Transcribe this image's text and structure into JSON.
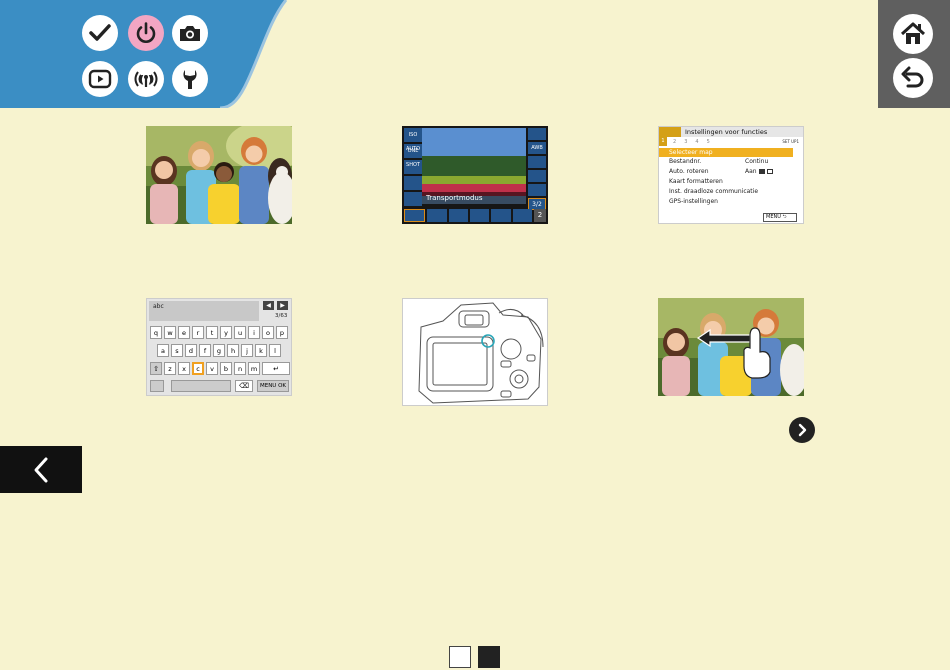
{
  "header": {
    "icons": [
      {
        "name": "check-icon",
        "style": "white"
      },
      {
        "name": "power-icon",
        "style": "pink"
      },
      {
        "name": "camera-icon",
        "style": "white"
      },
      {
        "name": "play-icon",
        "style": "white"
      },
      {
        "name": "wireless-icon",
        "style": "white"
      },
      {
        "name": "wrench-icon",
        "style": "white"
      }
    ],
    "right_buttons": [
      "home-icon",
      "return-icon"
    ]
  },
  "thumbs": {
    "menu_screen": {
      "title": "Instellingen voor functies",
      "tabs": [
        "1",
        "2",
        "3",
        "4",
        "5"
      ],
      "tab_right": "SET UP1",
      "rows": [
        {
          "label": "Selecteer map",
          "value": ""
        },
        {
          "label": "Bestandnr.",
          "value": "Continu"
        },
        {
          "label": "Auto. roteren",
          "value": "Aan"
        },
        {
          "label": "Kaart formatteren",
          "value": ""
        },
        {
          "label": "Inst. draadloze communicatie",
          "value": ""
        },
        {
          "label": "GPS-instellingen",
          "value": ""
        }
      ],
      "menu_button": "MENU"
    },
    "quick_screen": {
      "left_items": [
        "ISO AUTO",
        "ONE SHOT",
        "",
        "",
        "",
        "",
        ""
      ],
      "right_items": [
        "",
        "AWB",
        "",
        "",
        "",
        "3/2"
      ],
      "caption": "Transportmodus",
      "page_num": "2"
    },
    "keyboard": {
      "text": "abc",
      "counter": "3/63",
      "row1": [
        "q",
        "w",
        "e",
        "r",
        "t",
        "y",
        "u",
        "i",
        "o",
        "p"
      ],
      "row2": [
        "a",
        "s",
        "d",
        "f",
        "g",
        "h",
        "j",
        "k",
        "l"
      ],
      "row3": [
        "z",
        "x",
        "c",
        "v",
        "b",
        "n",
        "m"
      ],
      "selected_key": "c",
      "menu_ok": "MENU OK"
    }
  },
  "colors": {
    "background": "#f7f3cf",
    "header": "#3b8ec4",
    "accent": "#d4a017"
  }
}
